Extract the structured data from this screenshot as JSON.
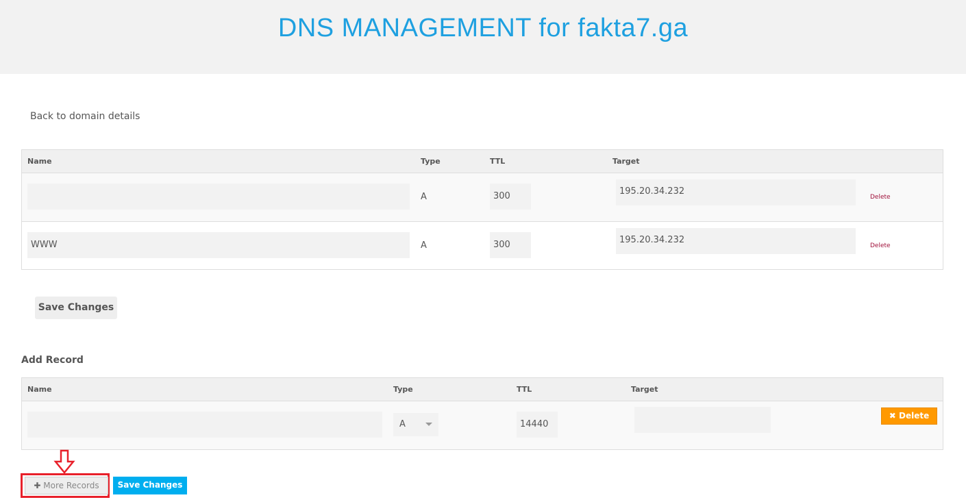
{
  "header": {
    "title": "DNS MANAGEMENT for fakta7.ga"
  },
  "back_link": "Back to domain details",
  "records": {
    "columns": [
      "Name",
      "Type",
      "TTL",
      "Target"
    ],
    "rows": [
      {
        "name": "",
        "type": "A",
        "ttl": "300",
        "target": "195.20.34.232",
        "delete": "Delete"
      },
      {
        "name": "WWW",
        "type": "A",
        "ttl": "300",
        "target": "195.20.34.232",
        "delete": "Delete"
      }
    ],
    "save_label": "Save Changes"
  },
  "add_record": {
    "heading": "Add Record",
    "columns": [
      "Name",
      "Type",
      "TTL",
      "Target"
    ],
    "row": {
      "name": "",
      "type": "A",
      "ttl": "14440",
      "target": "",
      "delete": "Delete"
    },
    "more_label": "More Records",
    "save_label": "Save Changes"
  },
  "colors": {
    "accent": "#00aeef",
    "delete_button": "#ff9900",
    "highlight": "#e8202a"
  }
}
